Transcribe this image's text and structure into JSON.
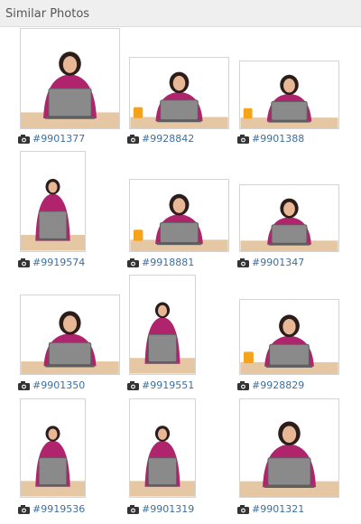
{
  "header": {
    "title": "Similar Photos"
  },
  "photos": [
    {
      "id": "#9901377"
    },
    {
      "id": "#9928842"
    },
    {
      "id": "#9901388"
    },
    {
      "id": "#9919574"
    },
    {
      "id": "#9918881"
    },
    {
      "id": "#9901347"
    },
    {
      "id": "#9901350"
    },
    {
      "id": "#9919551"
    },
    {
      "id": "#9928829"
    },
    {
      "id": "#9919536"
    },
    {
      "id": "#9901319"
    },
    {
      "id": "#9901321"
    }
  ],
  "colors": {
    "header_bg": "#efefef",
    "link": "#3d6f9e",
    "shirt": "#b0246e",
    "laptop": "#8a8a8a",
    "mug": "#f5a319",
    "desk": "#e6c7a3"
  }
}
